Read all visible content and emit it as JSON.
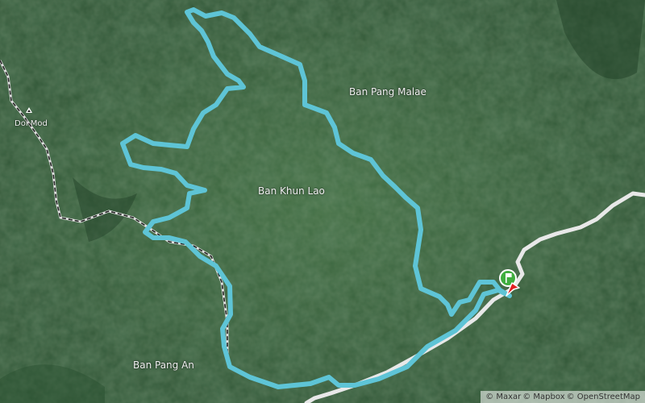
{
  "map": {
    "places": [
      {
        "id": "ban-pang-malae",
        "name": "Ban Pang Malae"
      },
      {
        "id": "ban-khun-lao",
        "name": "Ban Khun Lao"
      },
      {
        "id": "ban-pang-an",
        "name": "Ban Pang An"
      },
      {
        "id": "doi-mod",
        "name": "Doi Mod"
      }
    ],
    "attribution": {
      "maxar": "© Maxar",
      "mapbox": "© Mapbox",
      "osm": "© OpenStreetMap"
    },
    "colors": {
      "route": "#5ec4d6",
      "road": "#e8e8e8",
      "trail": "#1a1a1a",
      "start_marker": "#3fae3f",
      "end_marker": "#e02020"
    },
    "icons": [
      "peak-icon",
      "start-flag-icon",
      "end-flag-icon"
    ],
    "basemap": "satellite"
  }
}
